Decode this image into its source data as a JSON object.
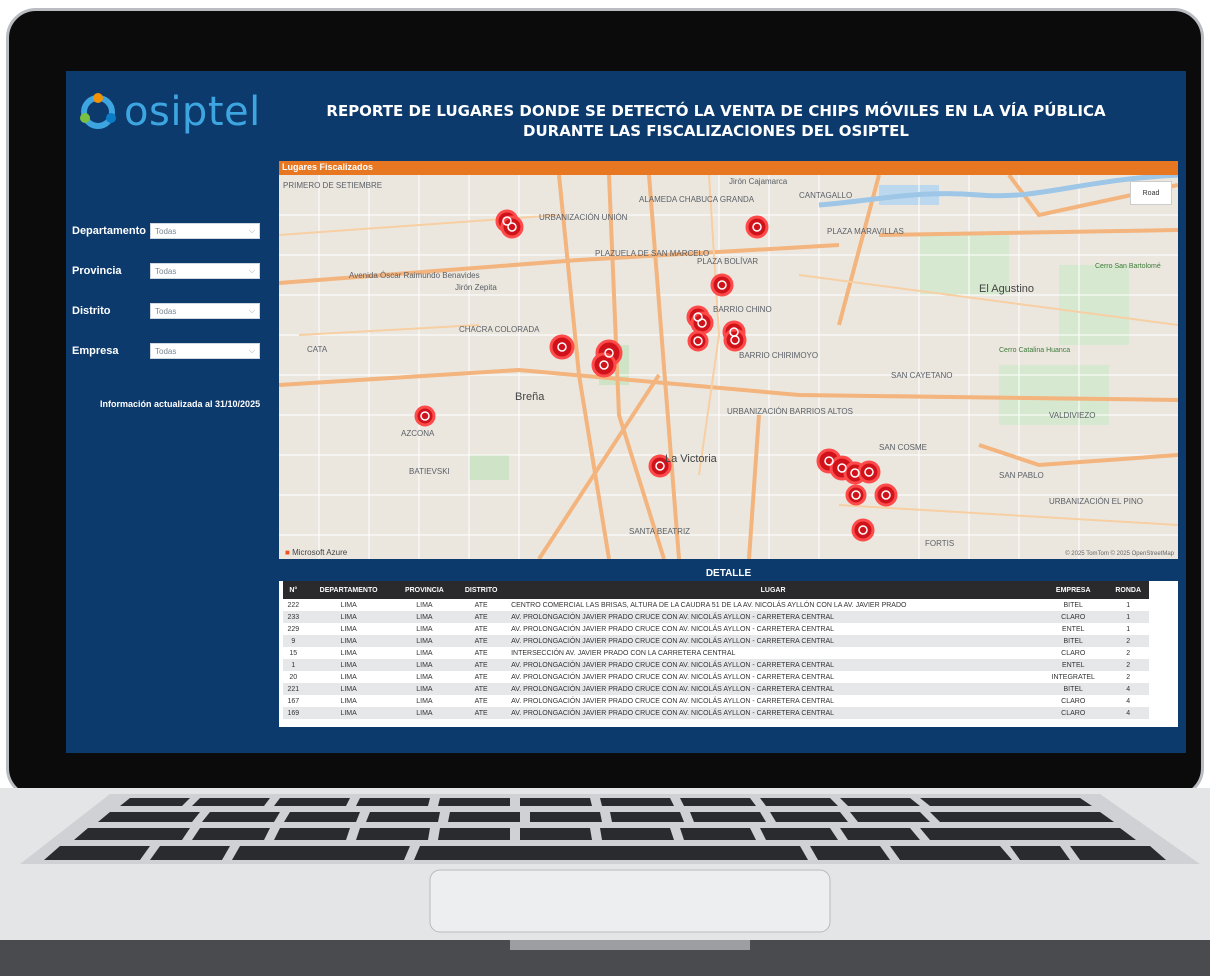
{
  "header": {
    "logo_text": "osiptel",
    "title": "REPORTE DE LUGARES DONDE SE DETECTÓ LA VENTA DE CHIPS MÓVILES EN LA VÍA PÚBLICA DURANTE LAS FISCALIZACIONES DEL OSIPTEL"
  },
  "filters": [
    {
      "label": "Departamento",
      "value": "Todas"
    },
    {
      "label": "Provincia",
      "value": "Todas"
    },
    {
      "label": "Distrito",
      "value": "Todas"
    },
    {
      "label": "Empresa",
      "value": "Todas"
    }
  ],
  "update_note": "Información actualizada al 31/10/2025",
  "map": {
    "header": "Lugares Fiscalizados",
    "road_button": "Road",
    "provider": "Microsoft Azure",
    "attribution": "© 2025 TomTom © 2025 OpenStreetMap",
    "labels": [
      "PRIMERO DE SETIEMBRE",
      "URBANIZACIÓN UNIÓN",
      "ALAMEDA CHABUCA GRANDA",
      "CANTAGALLO",
      "Jirón Cajamarca",
      "PLAZA MARAVILLAS",
      "PLAZUELA DE SAN MARCELO",
      "PLAZA BOLÍVAR",
      "El Agustino",
      "Cerro San Bartolomé",
      "Avenida Óscar Raimundo Benavides",
      "Jirón Zepita",
      "BARRIO CHINO",
      "CHACRA COLORADA",
      "CATA",
      "BARRIO CHIRIMOYO",
      "SAN CAYETANO",
      "Cerro Catalina Huanca",
      "Breña",
      "AZCONA",
      "URBANIZACIÓN BARRIOS ALTOS",
      "VALDIVIEZO",
      "BATIEVSKI",
      "La Victoria",
      "SAN COSME",
      "SAN PABLO",
      "URBANIZACIÓN EL PINO",
      "SANTA BEATRIZ",
      "FORTIS"
    ]
  },
  "table": {
    "title": "DETALLE",
    "columns": [
      "N°",
      "DEPARTAMENTO",
      "PROVINCIA",
      "DISTRITO",
      "LUGAR",
      "EMPRESA",
      "RONDA"
    ],
    "rows": [
      [
        "222",
        "LIMA",
        "LIMA",
        "ATE",
        "CENTRO COMERCIAL LAS BRISAS, ALTURA DE LA CAUDRA 51 DE LA AV. NICOLÁS AYLLÓN CON LA AV. JAVIER PRADO",
        "BITEL",
        "1"
      ],
      [
        "233",
        "LIMA",
        "LIMA",
        "ATE",
        "AV. PROLONGACIÓN JAVIER PRADO CRUCE CON AV. NICOLÁS AYLLON - CARRETERA CENTRAL",
        "CLARO",
        "1"
      ],
      [
        "229",
        "LIMA",
        "LIMA",
        "ATE",
        "AV. PROLONGACIÓN JAVIER PRADO CRUCE CON AV. NICOLÁS AYLLON - CARRETERA CENTRAL",
        "ENTEL",
        "1"
      ],
      [
        "9",
        "LIMA",
        "LIMA",
        "ATE",
        "AV. PROLONGACIÓN JAVIER PRADO CRUCE CON AV. NICOLÁS AYLLON - CARRETERA CENTRAL",
        "BITEL",
        "2"
      ],
      [
        "15",
        "LIMA",
        "LIMA",
        "ATE",
        "INTERSECCIÓN AV. JAVIER PRADO CON LA CARRETERA CENTRAL",
        "CLARO",
        "2"
      ],
      [
        "1",
        "LIMA",
        "LIMA",
        "ATE",
        "AV. PROLONGACIÓN JAVIER PRADO CRUCE CON AV. NICOLÁS AYLLON - CARRETERA CENTRAL",
        "ENTEL",
        "2"
      ],
      [
        "20",
        "LIMA",
        "LIMA",
        "ATE",
        "AV. PROLONGACIÓN JAVIER PRADO CRUCE CON AV. NICOLÁS AYLLON - CARRETERA CENTRAL",
        "INTEGRATEL",
        "2"
      ],
      [
        "221",
        "LIMA",
        "LIMA",
        "ATE",
        "AV. PROLONGACIÓN JAVIER PRADO CRUCE CON AV. NICOLÁS AYLLON - CARRETERA CENTRAL",
        "BITEL",
        "4"
      ],
      [
        "167",
        "LIMA",
        "LIMA",
        "ATE",
        "AV. PROLONGACIÓN JAVIER PRADO CRUCE CON AV. NICOLÁS AYLLON - CARRETERA CENTRAL",
        "CLARO",
        "4"
      ],
      [
        "169",
        "LIMA",
        "LIMA",
        "ATE",
        "AV. PROLONGACIÓN JAVIER PRADO CRUCE CON AV. NICOLÁS AYLLON - CARRETERA CENTRAL",
        "CLARO",
        "4"
      ]
    ]
  },
  "colors": {
    "screen_bg": "#0c3a6d",
    "accent_orange": "#e87722",
    "marker_red": "#d0121b",
    "logo_blue": "#3da5e0"
  }
}
